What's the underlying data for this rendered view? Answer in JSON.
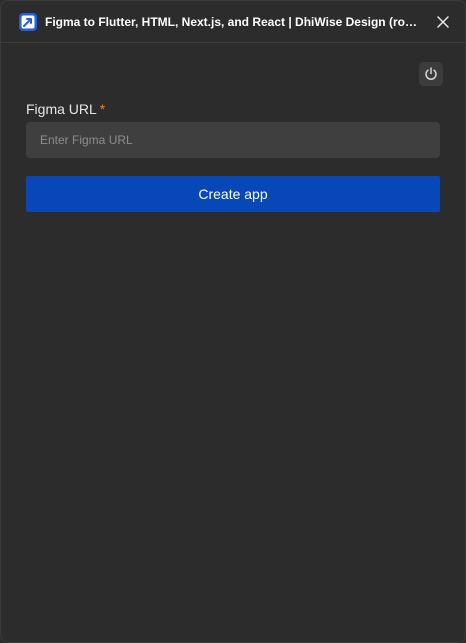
{
  "window": {
    "title": "Figma to Flutter, HTML, Next.js, and React | DhiWise Design (rocket.new)",
    "app_icon": "dhiwise-logo-icon",
    "close_icon": "close-icon"
  },
  "toolbar": {
    "power_icon": "power-icon"
  },
  "form": {
    "figma_url_label": "Figma URL",
    "required_marker": "*",
    "figma_url_placeholder": "Enter Figma URL",
    "figma_url_value": "",
    "create_button_label": "Create app"
  },
  "colors": {
    "background": "#2c2c2c",
    "input_background": "#3f3f3f",
    "primary_button": "#0747b8",
    "required_marker": "#f07b43"
  }
}
